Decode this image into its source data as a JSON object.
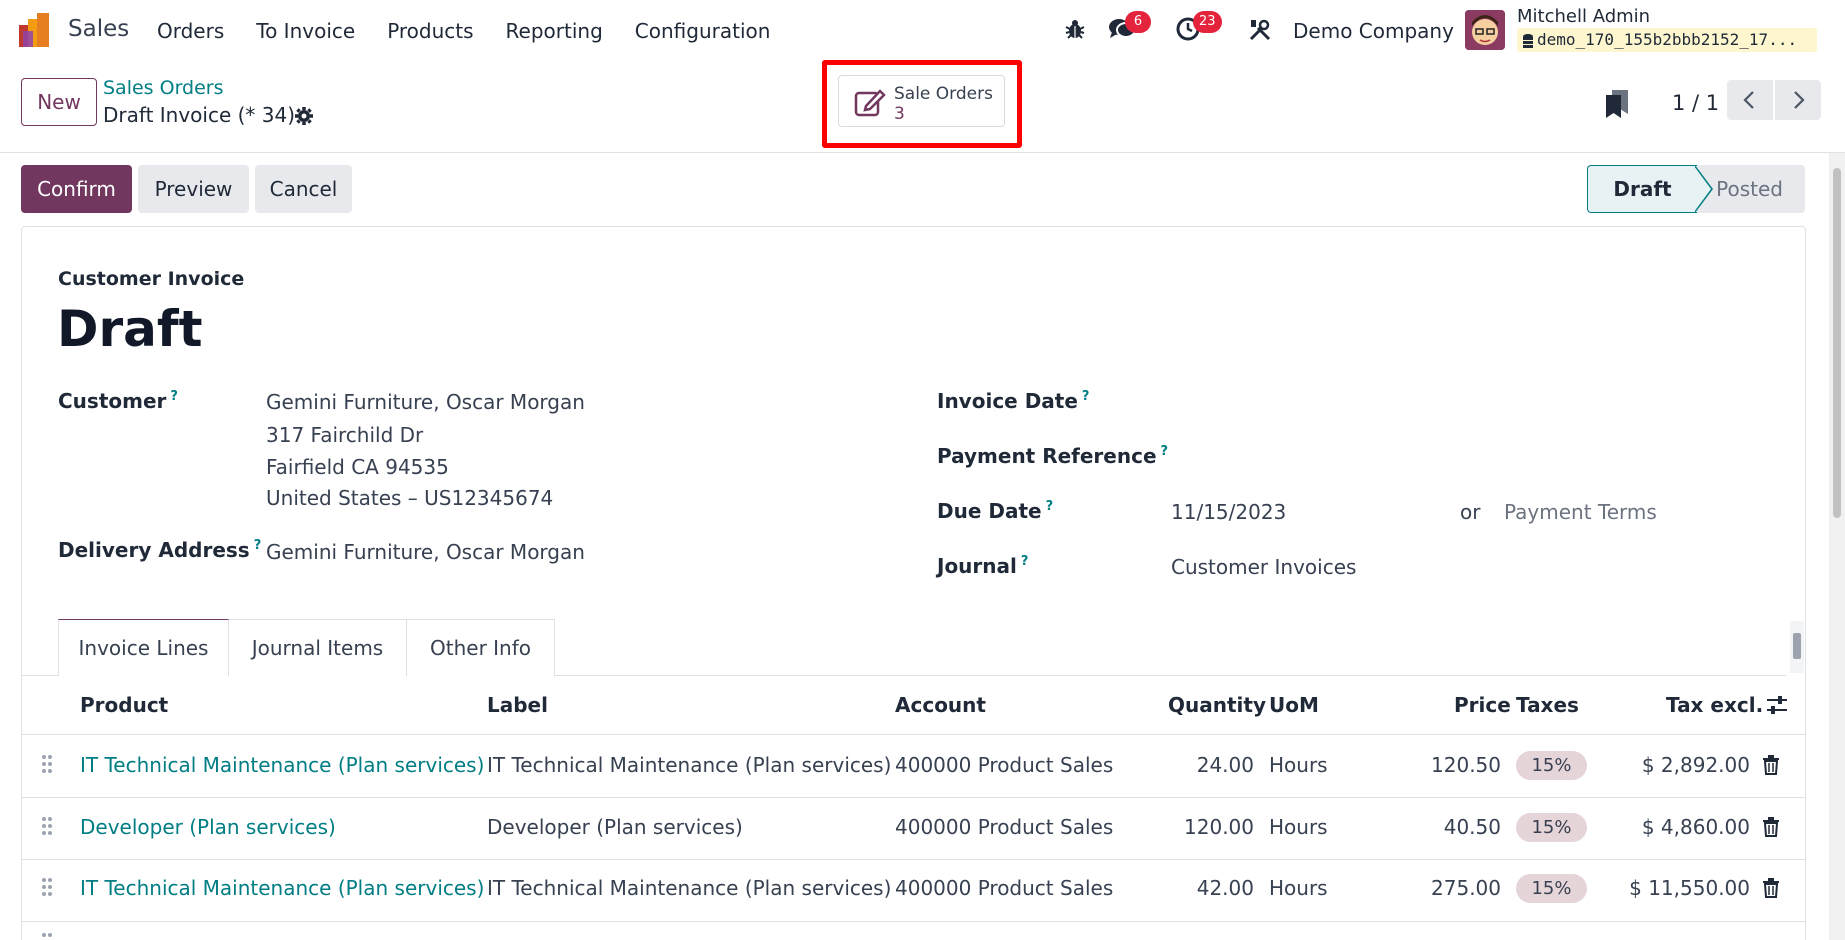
{
  "app": {
    "name": "Sales"
  },
  "nav": {
    "items": [
      "Orders",
      "To Invoice",
      "Products",
      "Reporting",
      "Configuration"
    ]
  },
  "systray": {
    "messages_count": "6",
    "activities_count": "23",
    "company": "Demo Company",
    "user_name": "Mitchell Admin",
    "database": "demo_170_155b2bbb2152_17..."
  },
  "control": {
    "new_label": "New",
    "breadcrumb": "Sales Orders",
    "record_title": "Draft Invoice (* 34)",
    "smart_button": {
      "label": "Sale Orders",
      "value": "3"
    },
    "pager": "1 / 1"
  },
  "actions": {
    "confirm": "Confirm",
    "preview": "Preview",
    "cancel": "Cancel"
  },
  "status": {
    "current": "Draft",
    "next": "Posted"
  },
  "form": {
    "subtitle": "Customer Invoice",
    "title": "Draft",
    "customer_label": "Customer",
    "customer_lines": [
      "Gemini Furniture, Oscar Morgan",
      "317 Fairchild Dr",
      "Fairfield CA 94535",
      "United States – US12345674"
    ],
    "delivery_label": "Delivery Address",
    "delivery_value": "Gemini Furniture, Oscar Morgan",
    "invoice_date_label": "Invoice Date",
    "payment_ref_label": "Payment Reference",
    "due_date_label": "Due Date",
    "due_date_value": "11/15/2023",
    "or_text": "or",
    "payment_terms_placeholder": "Payment Terms",
    "journal_label": "Journal",
    "journal_value": "Customer Invoices",
    "help_mark": "?"
  },
  "tabs": [
    "Invoice Lines",
    "Journal Items",
    "Other Info"
  ],
  "table": {
    "headers": [
      "Product",
      "Label",
      "Account",
      "Quantity",
      "UoM",
      "Price",
      "Taxes",
      "Tax excl."
    ],
    "rows": [
      {
        "product": "IT Technical Maintenance (Plan services)",
        "label": "IT Technical Maintenance (Plan services)",
        "account": "400000 Product Sales",
        "quantity": "24.00",
        "uom": "Hours",
        "price": "120.50",
        "tax": "15%",
        "subtotal": "$ 2,892.00"
      },
      {
        "product": "Developer (Plan services)",
        "label": "Developer (Plan services)",
        "account": "400000 Product Sales",
        "quantity": "120.00",
        "uom": "Hours",
        "price": "40.50",
        "tax": "15%",
        "subtotal": "$ 4,860.00"
      },
      {
        "product": "IT Technical Maintenance (Plan services)",
        "label": "IT Technical Maintenance (Plan services)",
        "account": "400000 Product Sales",
        "quantity": "42.00",
        "uom": "Hours",
        "price": "275.00",
        "tax": "15%",
        "subtotal": "$ 11,550.00"
      }
    ]
  },
  "colors": {
    "brand": "#71375f",
    "link": "#017e84",
    "badge": "#e4243c",
    "highlight": "#ff0000"
  },
  "icons": [
    "app-logo-icon",
    "bug-icon",
    "chat-icon",
    "clock-icon",
    "tools-icon",
    "database-icon",
    "gear-icon",
    "pencil-square-icon",
    "bookmark-icon",
    "chevron-left-icon",
    "chevron-right-icon",
    "grip-icon",
    "trash-icon",
    "sliders-icon"
  ]
}
